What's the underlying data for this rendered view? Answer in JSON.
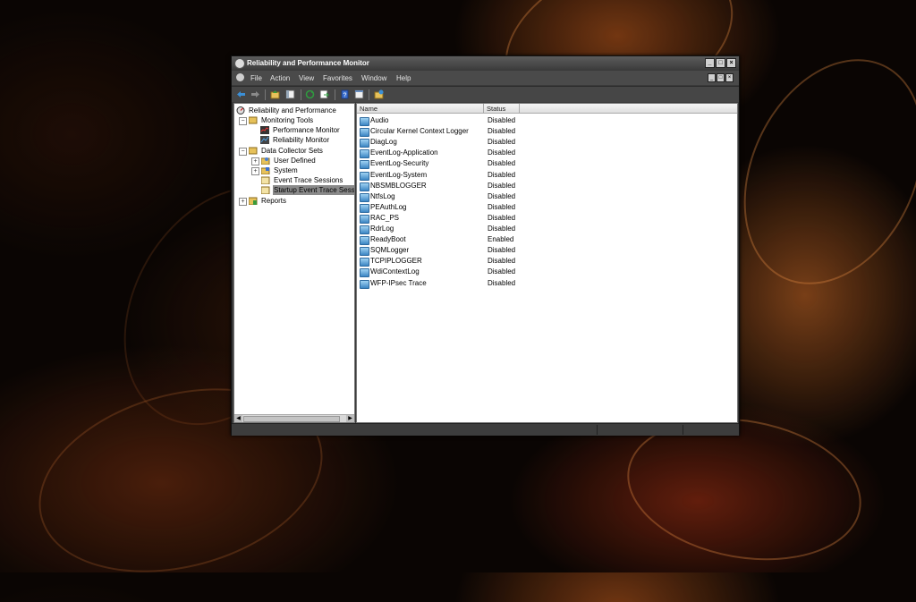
{
  "window": {
    "title": "Reliability and Performance Monitor"
  },
  "menu": [
    "File",
    "Action",
    "View",
    "Favorites",
    "Window",
    "Help"
  ],
  "tree": {
    "root": "Reliability and Performance",
    "monitoring_tools": "Monitoring Tools",
    "performance_monitor": "Performance Monitor",
    "reliability_monitor": "Reliability Monitor",
    "data_collector_sets": "Data Collector Sets",
    "user_defined": "User Defined",
    "system": "System",
    "event_trace_sessions": "Event Trace Sessions",
    "startup_event_trace_sessions": "Startup Event Trace Sess",
    "reports": "Reports",
    "expanded_glyph": "−",
    "collapsed_glyph": "+"
  },
  "list": {
    "columns": {
      "name": "Name",
      "status": "Status"
    },
    "rows": [
      {
        "name": "Audio",
        "status": "Disabled"
      },
      {
        "name": "Circular Kernel Context Logger",
        "status": "Disabled"
      },
      {
        "name": "DiagLog",
        "status": "Disabled"
      },
      {
        "name": "EventLog-Application",
        "status": "Disabled"
      },
      {
        "name": "EventLog-Security",
        "status": "Disabled"
      },
      {
        "name": "EventLog-System",
        "status": "Disabled"
      },
      {
        "name": "NBSMBLOGGER",
        "status": "Disabled"
      },
      {
        "name": "NtfsLog",
        "status": "Disabled"
      },
      {
        "name": "PEAuthLog",
        "status": "Disabled"
      },
      {
        "name": "RAC_PS",
        "status": "Disabled"
      },
      {
        "name": "RdrLog",
        "status": "Disabled"
      },
      {
        "name": "ReadyBoot",
        "status": "Enabled"
      },
      {
        "name": "SQMLogger",
        "status": "Disabled"
      },
      {
        "name": "TCPIPLOGGER",
        "status": "Disabled"
      },
      {
        "name": "WdiContextLog",
        "status": "Disabled"
      },
      {
        "name": "WFP-IPsec Trace",
        "status": "Disabled"
      }
    ]
  },
  "colors": {
    "window_chrome": "#3a3a3a",
    "back_arrow": "#3b8fd6",
    "selection": "#8a8a8a"
  }
}
